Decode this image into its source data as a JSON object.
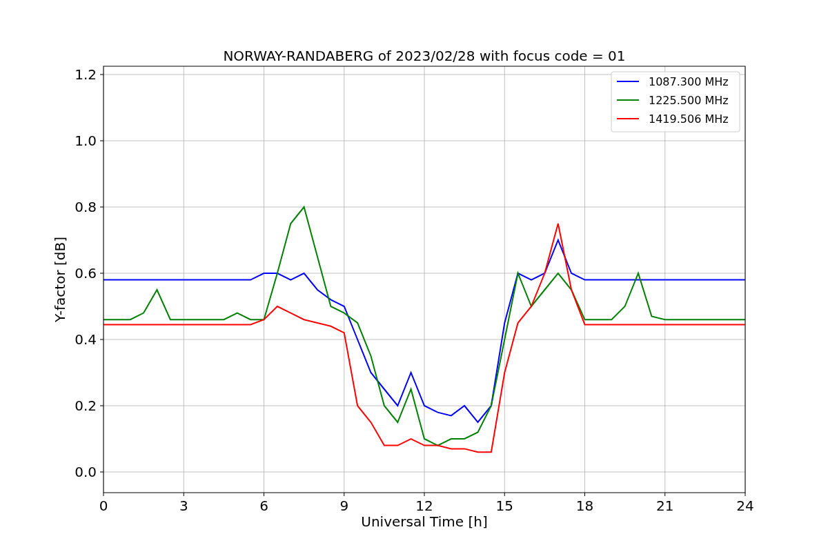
{
  "figure": {
    "chart_data": {
      "type": "line",
      "title": "NORWAY-RANDABERG of 2023/02/28 with focus code = 01",
      "xlabel": "Universal Time [h]",
      "ylabel": "Y-factor [dB]",
      "x": [
        0,
        0.5,
        1,
        1.5,
        2,
        2.5,
        3,
        3.5,
        4,
        4.5,
        5,
        5.5,
        6,
        6.5,
        7,
        7.5,
        8,
        8.5,
        9,
        9.5,
        10,
        10.5,
        11,
        11.5,
        12,
        12.5,
        13,
        13.5,
        14,
        14.5,
        15,
        15.5,
        16,
        16.5,
        17,
        17.5,
        18,
        18.5,
        19,
        19.5,
        20,
        20.5,
        21,
        21.5,
        22,
        22.5,
        23,
        23.5,
        24
      ],
      "series": [
        {
          "name": "1087.300 MHz",
          "color": "#0000ff",
          "values": [
            0.58,
            0.58,
            0.58,
            0.58,
            0.58,
            0.58,
            0.58,
            0.58,
            0.58,
            0.58,
            0.58,
            0.58,
            0.6,
            0.6,
            0.58,
            0.6,
            0.55,
            0.52,
            0.5,
            0.4,
            0.3,
            0.25,
            0.2,
            0.3,
            0.2,
            0.18,
            0.17,
            0.2,
            0.15,
            0.2,
            0.45,
            0.6,
            0.58,
            0.6,
            0.7,
            0.6,
            0.58,
            0.58,
            0.58,
            0.58,
            0.58,
            0.58,
            0.58,
            0.58,
            0.58,
            0.58,
            0.58,
            0.58,
            0.58
          ]
        },
        {
          "name": "1225.500 MHz",
          "color": "#008000",
          "values": [
            0.46,
            0.46,
            0.46,
            0.48,
            0.55,
            0.46,
            0.46,
            0.46,
            0.46,
            0.46,
            0.48,
            0.46,
            0.46,
            0.6,
            0.75,
            0.8,
            0.65,
            0.5,
            0.48,
            0.45,
            0.35,
            0.2,
            0.15,
            0.25,
            0.1,
            0.08,
            0.1,
            0.1,
            0.12,
            0.2,
            0.4,
            0.6,
            0.5,
            0.55,
            0.6,
            0.55,
            0.46,
            0.46,
            0.46,
            0.5,
            0.6,
            0.47,
            0.46,
            0.46,
            0.46,
            0.46,
            0.46,
            0.46,
            0.46
          ]
        },
        {
          "name": "1419.506 MHz",
          "color": "#ff0000",
          "values": [
            0.445,
            0.445,
            0.445,
            0.445,
            0.445,
            0.445,
            0.445,
            0.445,
            0.445,
            0.445,
            0.445,
            0.445,
            0.46,
            0.5,
            0.48,
            0.46,
            0.45,
            0.44,
            0.42,
            0.2,
            0.15,
            0.08,
            0.08,
            0.1,
            0.08,
            0.08,
            0.07,
            0.07,
            0.06,
            0.06,
            0.3,
            0.45,
            0.5,
            0.6,
            0.75,
            0.55,
            0.445,
            0.445,
            0.445,
            0.445,
            0.445,
            0.445,
            0.445,
            0.445,
            0.445,
            0.445,
            0.445,
            0.445,
            0.445
          ]
        }
      ],
      "grid": true,
      "legend": "upper right",
      "xlim": [
        0,
        24
      ],
      "ylim": [
        -0.0625,
        1.225
      ],
      "xticks": [
        0,
        3,
        6,
        9,
        12,
        15,
        18,
        21,
        24
      ],
      "yticks": [
        {
          "value": 0,
          "label": "0.0"
        },
        {
          "value": 0.2,
          "label": "0.2"
        },
        {
          "value": 0.4,
          "label": "0.4"
        },
        {
          "value": 0.6,
          "label": "0.6"
        },
        {
          "value": 0.8,
          "label": "0.8"
        },
        {
          "value": 1,
          "label": "1.0"
        },
        {
          "value": 1.2,
          "label": "1.2"
        }
      ]
    }
  }
}
